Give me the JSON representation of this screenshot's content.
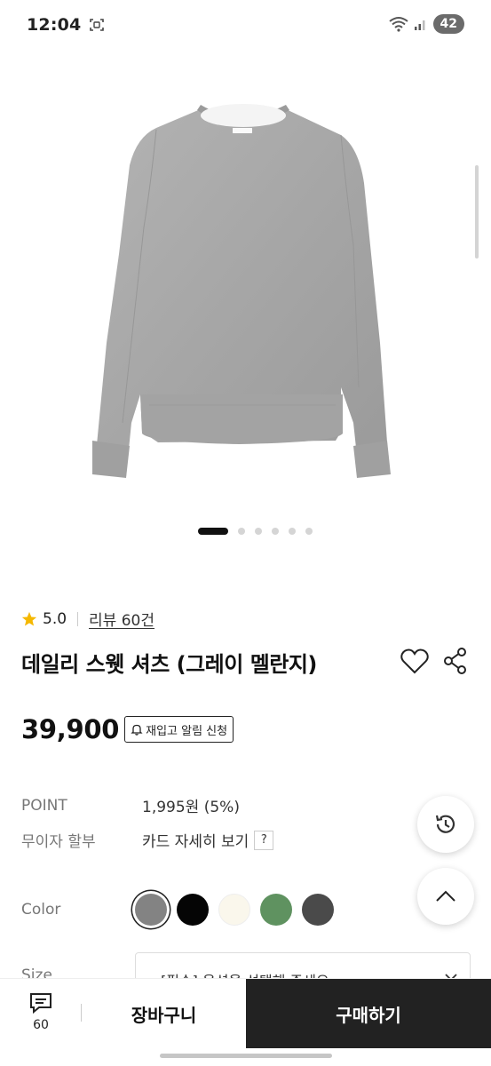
{
  "status_bar": {
    "time": "12:04",
    "battery": "42",
    "wifi_label": "5"
  },
  "product": {
    "image_icon": "sweatshirt-image",
    "carousel": {
      "total": 6,
      "active": 1
    },
    "rating": {
      "score": "5.0",
      "review_label": "리뷰 60건"
    },
    "title": "데일리 스웻 셔츠 (그레이 멜란지)",
    "price": "39,900",
    "restock_label": "재입고 알림 신청"
  },
  "benefits": {
    "point_label": "POINT",
    "point_value": "1,995원 (5%)",
    "installment_label": "무이자 할부",
    "installment_value": "카드 자세히 보기",
    "help_icon_text": "?"
  },
  "options": {
    "color_label": "Color",
    "swatches": [
      {
        "name": "gray",
        "color": "#838383",
        "selected": true
      },
      {
        "name": "black",
        "color": "#050505",
        "selected": false
      },
      {
        "name": "cream",
        "color": "#faf7ec",
        "selected": false
      },
      {
        "name": "green",
        "color": "#5f9260",
        "selected": false
      },
      {
        "name": "charcoal",
        "color": "#4a4a4a",
        "selected": false
      }
    ],
    "size_label": "Size",
    "size_placeholder": "[필수] 옵션을 선택해 주세요"
  },
  "floating": {
    "history_icon": "history-icon",
    "top_icon": "chevron-up-icon"
  },
  "bottom_bar": {
    "chat_count": "60",
    "cart_label": "장바구니",
    "buy_label": "구매하기"
  },
  "colors": {
    "accent_star": "#f5b800",
    "buy_button": "#222222"
  }
}
